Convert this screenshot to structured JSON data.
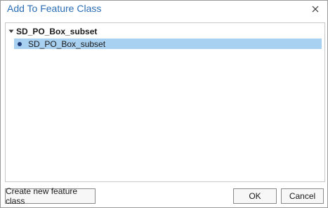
{
  "dialog": {
    "title": "Add To Feature Class",
    "close_icon": "close-icon"
  },
  "tree": {
    "root": {
      "label": "SD_PO_Box_subset",
      "expanded": true,
      "icon": "chevron-down-icon"
    },
    "children": [
      {
        "label": "SD_PO_Box_subset",
        "selected": true,
        "icon": "point-feature-icon"
      }
    ]
  },
  "buttons": {
    "create_label": "Create new feature class",
    "ok_label": "OK",
    "cancel_label": "Cancel"
  },
  "colors": {
    "title": "#2a6db5",
    "selection": "#a8d0f0",
    "point_symbol": "#1e3c7a"
  }
}
